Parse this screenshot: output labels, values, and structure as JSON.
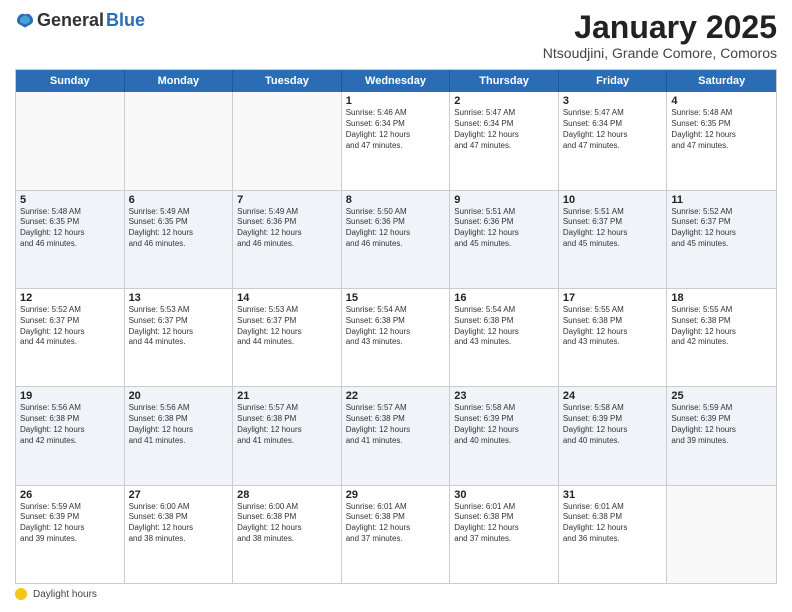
{
  "logo": {
    "general": "General",
    "blue": "Blue"
  },
  "title": "January 2025",
  "subtitle": "Ntsoudjini, Grande Comore, Comoros",
  "days_of_week": [
    "Sunday",
    "Monday",
    "Tuesday",
    "Wednesday",
    "Thursday",
    "Friday",
    "Saturday"
  ],
  "footer": {
    "icon_label": "daylight-icon",
    "text": "Daylight hours"
  },
  "weeks": [
    {
      "row_alt": false,
      "cells": [
        {
          "day": "",
          "empty": true,
          "lines": []
        },
        {
          "day": "",
          "empty": true,
          "lines": []
        },
        {
          "day": "",
          "empty": true,
          "lines": []
        },
        {
          "day": "1",
          "empty": false,
          "lines": [
            "Sunrise: 5:46 AM",
            "Sunset: 6:34 PM",
            "Daylight: 12 hours",
            "and 47 minutes."
          ]
        },
        {
          "day": "2",
          "empty": false,
          "lines": [
            "Sunrise: 5:47 AM",
            "Sunset: 6:34 PM",
            "Daylight: 12 hours",
            "and 47 minutes."
          ]
        },
        {
          "day": "3",
          "empty": false,
          "lines": [
            "Sunrise: 5:47 AM",
            "Sunset: 6:34 PM",
            "Daylight: 12 hours",
            "and 47 minutes."
          ]
        },
        {
          "day": "4",
          "empty": false,
          "lines": [
            "Sunrise: 5:48 AM",
            "Sunset: 6:35 PM",
            "Daylight: 12 hours",
            "and 47 minutes."
          ]
        }
      ]
    },
    {
      "row_alt": true,
      "cells": [
        {
          "day": "5",
          "empty": false,
          "lines": [
            "Sunrise: 5:48 AM",
            "Sunset: 6:35 PM",
            "Daylight: 12 hours",
            "and 46 minutes."
          ]
        },
        {
          "day": "6",
          "empty": false,
          "lines": [
            "Sunrise: 5:49 AM",
            "Sunset: 6:35 PM",
            "Daylight: 12 hours",
            "and 46 minutes."
          ]
        },
        {
          "day": "7",
          "empty": false,
          "lines": [
            "Sunrise: 5:49 AM",
            "Sunset: 6:36 PM",
            "Daylight: 12 hours",
            "and 46 minutes."
          ]
        },
        {
          "day": "8",
          "empty": false,
          "lines": [
            "Sunrise: 5:50 AM",
            "Sunset: 6:36 PM",
            "Daylight: 12 hours",
            "and 46 minutes."
          ]
        },
        {
          "day": "9",
          "empty": false,
          "lines": [
            "Sunrise: 5:51 AM",
            "Sunset: 6:36 PM",
            "Daylight: 12 hours",
            "and 45 minutes."
          ]
        },
        {
          "day": "10",
          "empty": false,
          "lines": [
            "Sunrise: 5:51 AM",
            "Sunset: 6:37 PM",
            "Daylight: 12 hours",
            "and 45 minutes."
          ]
        },
        {
          "day": "11",
          "empty": false,
          "lines": [
            "Sunrise: 5:52 AM",
            "Sunset: 6:37 PM",
            "Daylight: 12 hours",
            "and 45 minutes."
          ]
        }
      ]
    },
    {
      "row_alt": false,
      "cells": [
        {
          "day": "12",
          "empty": false,
          "lines": [
            "Sunrise: 5:52 AM",
            "Sunset: 6:37 PM",
            "Daylight: 12 hours",
            "and 44 minutes."
          ]
        },
        {
          "day": "13",
          "empty": false,
          "lines": [
            "Sunrise: 5:53 AM",
            "Sunset: 6:37 PM",
            "Daylight: 12 hours",
            "and 44 minutes."
          ]
        },
        {
          "day": "14",
          "empty": false,
          "lines": [
            "Sunrise: 5:53 AM",
            "Sunset: 6:37 PM",
            "Daylight: 12 hours",
            "and 44 minutes."
          ]
        },
        {
          "day": "15",
          "empty": false,
          "lines": [
            "Sunrise: 5:54 AM",
            "Sunset: 6:38 PM",
            "Daylight: 12 hours",
            "and 43 minutes."
          ]
        },
        {
          "day": "16",
          "empty": false,
          "lines": [
            "Sunrise: 5:54 AM",
            "Sunset: 6:38 PM",
            "Daylight: 12 hours",
            "and 43 minutes."
          ]
        },
        {
          "day": "17",
          "empty": false,
          "lines": [
            "Sunrise: 5:55 AM",
            "Sunset: 6:38 PM",
            "Daylight: 12 hours",
            "and 43 minutes."
          ]
        },
        {
          "day": "18",
          "empty": false,
          "lines": [
            "Sunrise: 5:55 AM",
            "Sunset: 6:38 PM",
            "Daylight: 12 hours",
            "and 42 minutes."
          ]
        }
      ]
    },
    {
      "row_alt": true,
      "cells": [
        {
          "day": "19",
          "empty": false,
          "lines": [
            "Sunrise: 5:56 AM",
            "Sunset: 6:38 PM",
            "Daylight: 12 hours",
            "and 42 minutes."
          ]
        },
        {
          "day": "20",
          "empty": false,
          "lines": [
            "Sunrise: 5:56 AM",
            "Sunset: 6:38 PM",
            "Daylight: 12 hours",
            "and 41 minutes."
          ]
        },
        {
          "day": "21",
          "empty": false,
          "lines": [
            "Sunrise: 5:57 AM",
            "Sunset: 6:38 PM",
            "Daylight: 12 hours",
            "and 41 minutes."
          ]
        },
        {
          "day": "22",
          "empty": false,
          "lines": [
            "Sunrise: 5:57 AM",
            "Sunset: 6:38 PM",
            "Daylight: 12 hours",
            "and 41 minutes."
          ]
        },
        {
          "day": "23",
          "empty": false,
          "lines": [
            "Sunrise: 5:58 AM",
            "Sunset: 6:39 PM",
            "Daylight: 12 hours",
            "and 40 minutes."
          ]
        },
        {
          "day": "24",
          "empty": false,
          "lines": [
            "Sunrise: 5:58 AM",
            "Sunset: 6:39 PM",
            "Daylight: 12 hours",
            "and 40 minutes."
          ]
        },
        {
          "day": "25",
          "empty": false,
          "lines": [
            "Sunrise: 5:59 AM",
            "Sunset: 6:39 PM",
            "Daylight: 12 hours",
            "and 39 minutes."
          ]
        }
      ]
    },
    {
      "row_alt": false,
      "cells": [
        {
          "day": "26",
          "empty": false,
          "lines": [
            "Sunrise: 5:59 AM",
            "Sunset: 6:39 PM",
            "Daylight: 12 hours",
            "and 39 minutes."
          ]
        },
        {
          "day": "27",
          "empty": false,
          "lines": [
            "Sunrise: 6:00 AM",
            "Sunset: 6:38 PM",
            "Daylight: 12 hours",
            "and 38 minutes."
          ]
        },
        {
          "day": "28",
          "empty": false,
          "lines": [
            "Sunrise: 6:00 AM",
            "Sunset: 6:38 PM",
            "Daylight: 12 hours",
            "and 38 minutes."
          ]
        },
        {
          "day": "29",
          "empty": false,
          "lines": [
            "Sunrise: 6:01 AM",
            "Sunset: 6:38 PM",
            "Daylight: 12 hours",
            "and 37 minutes."
          ]
        },
        {
          "day": "30",
          "empty": false,
          "lines": [
            "Sunrise: 6:01 AM",
            "Sunset: 6:38 PM",
            "Daylight: 12 hours",
            "and 37 minutes."
          ]
        },
        {
          "day": "31",
          "empty": false,
          "lines": [
            "Sunrise: 6:01 AM",
            "Sunset: 6:38 PM",
            "Daylight: 12 hours",
            "and 36 minutes."
          ]
        },
        {
          "day": "",
          "empty": true,
          "lines": []
        }
      ]
    }
  ]
}
